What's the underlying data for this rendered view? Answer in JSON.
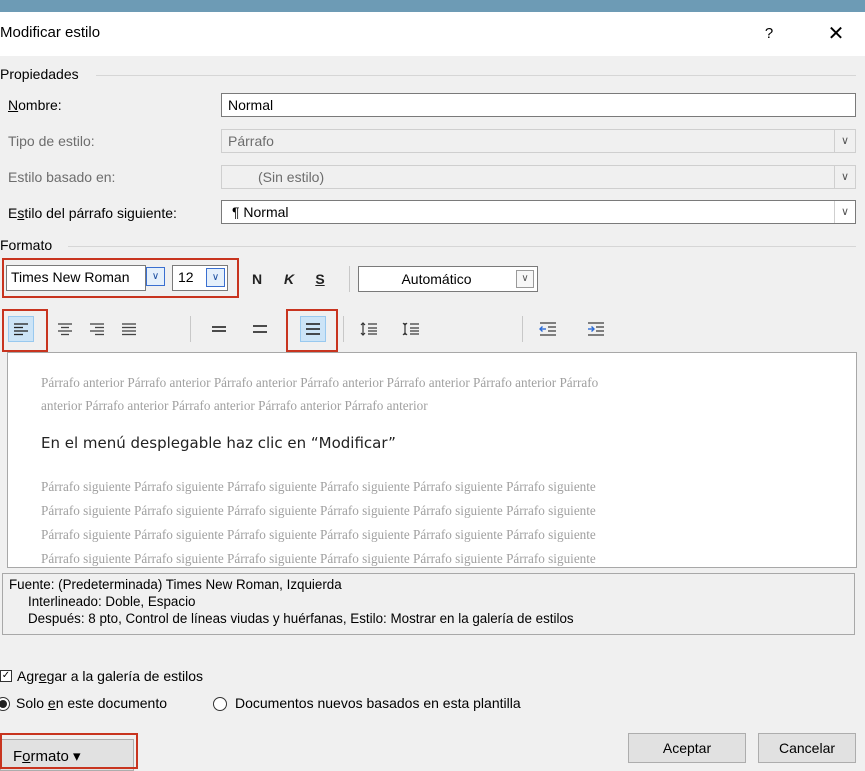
{
  "window": {
    "title": "Modificar estilo",
    "help_glyph": "?",
    "close_glyph": "✕"
  },
  "properties": {
    "section_label": "Propiedades",
    "nombre": {
      "label_u": "N",
      "label_rest": "ombre:",
      "value": "Normal"
    },
    "tipo_estilo": {
      "label": "Tipo de estilo:",
      "value": "Párrafo"
    },
    "estilo_basado": {
      "label": "Estilo basado en:",
      "value": "(Sin estilo)"
    },
    "estilo_siguiente": {
      "label_pre": "E",
      "label_u": "s",
      "label_rest": "tilo del párrafo siguiente:",
      "value": "¶  Normal"
    }
  },
  "format": {
    "section_label": "Formato",
    "font_name": "Times New Roman",
    "font_size": "12",
    "bold_label": "N",
    "italic_label": "K",
    "underline_label": "S",
    "color": "Automático"
  },
  "preview": {
    "previous_lines": [
      "Párrafo anterior Párrafo anterior Párrafo anterior Párrafo anterior Párrafo anterior Párrafo anterior Párrafo",
      "anterior Párrafo anterior Párrafo anterior Párrafo anterior Párrafo anterior"
    ],
    "sample_text": "En el menú desplegable haz clic en “Modificar”",
    "following_lines": [
      "Párrafo siguiente Párrafo siguiente Párrafo siguiente Párrafo siguiente Párrafo siguiente Párrafo siguiente",
      "Párrafo siguiente Párrafo siguiente Párrafo siguiente Párrafo siguiente Párrafo siguiente Párrafo siguiente",
      "Párrafo siguiente Párrafo siguiente Párrafo siguiente Párrafo siguiente Párrafo siguiente Párrafo siguiente",
      "Párrafo siguiente Párrafo siguiente Párrafo siguiente Párrafo siguiente Párrafo siguiente Párrafo siguiente"
    ]
  },
  "description": {
    "line1": "Fuente: (Predeterminada) Times New Roman, Izquierda",
    "line2": "Interlineado:  Doble, Espacio",
    "line3": "Después:  8 pto, Control de líneas viudas y huérfanas, Estilo: Mostrar en la galería de estilos"
  },
  "options": {
    "add_gallery": {
      "pre": "Agr",
      "u": "e",
      "rest": "gar a la galería de estilos",
      "checked": true
    },
    "solo_documento": {
      "pre": "Solo ",
      "u": "e",
      "rest": "n este documento",
      "selected": true
    },
    "nuevos_documentos": {
      "label": "Documentos nuevos basados en esta plantilla",
      "selected": false
    }
  },
  "buttons": {
    "formato_pre": "F",
    "formato_u": "o",
    "formato_rest": "rmato ▾",
    "aceptar": "Aceptar",
    "cancelar": "Cancelar"
  },
  "colors": {
    "highlight_box": "#c8341f",
    "selected_button": "#cce4f7",
    "preview_gray": "#a0a0a0"
  },
  "icons": {
    "align": [
      "align-left-icon",
      "align-center-icon",
      "align-right-icon",
      "align-justify-icon"
    ],
    "spacing": [
      "single-spacing-icon",
      "one-and-half-spacing-icon",
      "double-spacing-icon"
    ],
    "paragraph": [
      "increase-paragraph-spacing-icon",
      "decrease-paragraph-spacing-icon"
    ],
    "indent": [
      "decrease-indent-icon",
      "increase-indent-icon"
    ]
  }
}
